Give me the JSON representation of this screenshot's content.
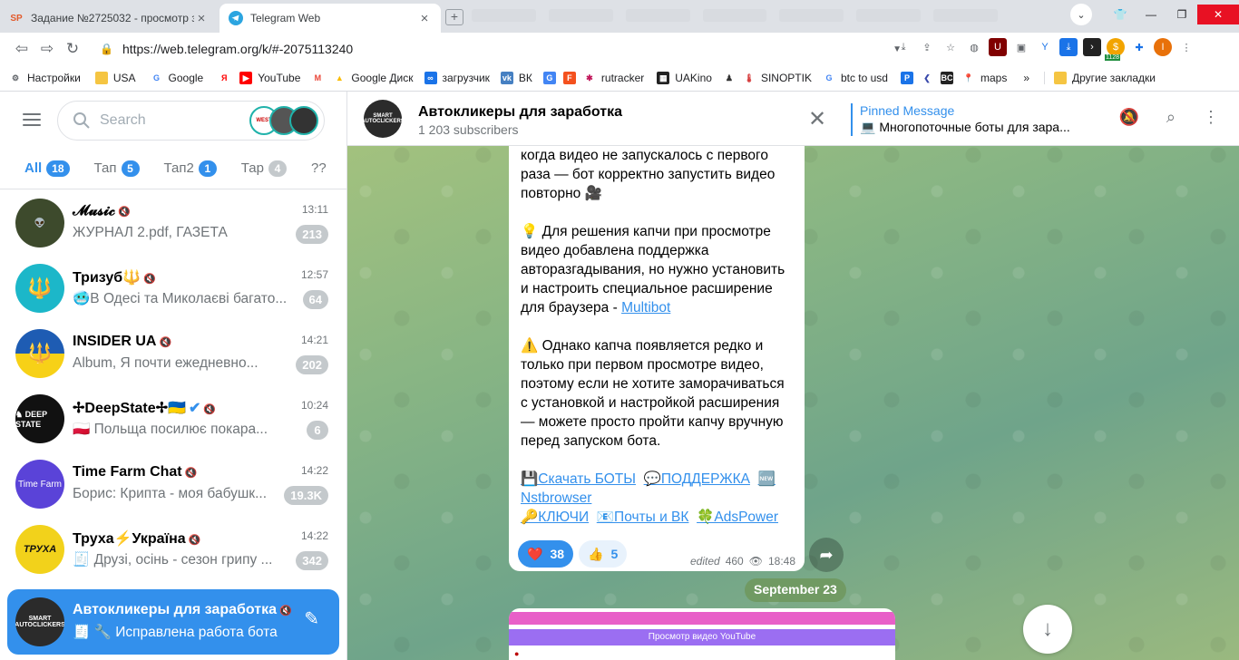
{
  "browser": {
    "tabs": [
      {
        "title": "Задание №2725032 - просмотр за...",
        "favicon": "SP",
        "active": false
      },
      {
        "title": "Telegram Web",
        "favicon": "telegram-icon",
        "active": true
      }
    ],
    "url": "https://web.telegram.org/k/#-2075113240",
    "ext_counter": "1128",
    "bookmarks": [
      {
        "label": "Настройки",
        "icon": "gear-icon"
      },
      {
        "label": "USA",
        "icon": "folder-icon"
      },
      {
        "label": "Google",
        "icon": "google-icon"
      },
      {
        "label": "",
        "icon": "yandex-icon"
      },
      {
        "label": "YouTube",
        "icon": "youtube-icon"
      },
      {
        "label": "",
        "icon": "gmail-icon"
      },
      {
        "label": "Google Диск",
        "icon": "drive-icon"
      },
      {
        "label": "загрузчик",
        "icon": "loader-icon"
      },
      {
        "label": "ВК",
        "icon": "vk-icon"
      },
      {
        "label": "",
        "icon": "translate-icon"
      },
      {
        "label": "",
        "icon": "f-icon"
      },
      {
        "label": "rutracker",
        "icon": "rutracker-icon"
      },
      {
        "label": "UAKino",
        "icon": "uakino-icon"
      },
      {
        "label": "",
        "icon": "person-icon"
      },
      {
        "label": "SINOPTIK",
        "icon": "thermometer-icon"
      },
      {
        "label": "btc to usd",
        "icon": "google-icon"
      },
      {
        "label": "",
        "icon": "p-icon"
      },
      {
        "label": "",
        "icon": "arrow-icon"
      },
      {
        "label": "",
        "icon": "bc-icon"
      },
      {
        "label": "maps",
        "icon": "maps-icon"
      }
    ],
    "bookmarks_more": "»",
    "other_bookmarks": "Другие закладки"
  },
  "sidebar": {
    "search_placeholder": "Search",
    "filters": [
      {
        "label": "All",
        "count": "18",
        "active": true
      },
      {
        "label": "Тап",
        "count": "5"
      },
      {
        "label": "Тап2",
        "count": "1"
      },
      {
        "label": "Тар",
        "count": "4"
      },
      {
        "label": "??",
        "count": ""
      }
    ],
    "chats": [
      {
        "name": "𝓜𝓾𝓼𝓲𝓬",
        "time": "13:11",
        "preview": "ЖУРНАЛ 2.pdf, ГАЗЕТА",
        "badge": "213",
        "avatar_color": "#3d4a2c"
      },
      {
        "name": "Тризуб🔱",
        "time": "12:57",
        "preview": "🥶В Одесі та Миколаєві багато...",
        "badge": "64",
        "avatar_color": "#1cb7c9"
      },
      {
        "name": "INSIDER UA",
        "time": "14:21",
        "preview": "Album, Я почти ежедневно...",
        "badge": "202",
        "avatar_color": "#1e5cb3"
      },
      {
        "name": "✢DeepState✢🇺🇦",
        "time": "10:24",
        "preview": "🇵🇱 Польща посилює покара...",
        "badge": "6",
        "avatar_color": "#111111"
      },
      {
        "name": "Time Farm Chat",
        "time": "14:22",
        "preview": "Борис: Крипта - моя бабушк...",
        "badge": "19.3K",
        "avatar_color": "#5a43d8"
      },
      {
        "name": "Труха⚡Україна",
        "time": "14:22",
        "preview": "🧾 Друзі, осінь - сезон грипу ...",
        "badge": "342",
        "avatar_color": "#f2d21b"
      },
      {
        "name": "Автокликеры для заработка",
        "time": "",
        "preview": "🧾 🔧 Исправлена работа бота",
        "badge": "",
        "avatar_color": "#2b2b2b"
      }
    ]
  },
  "chat": {
    "title": "Автокликеры для заработка",
    "subscribers": "1 203 subscribers",
    "pinned_label": "Pinned Message",
    "pinned_text": "💻 Многопоточные боты для зара...",
    "message": {
      "p1": "когда видео не запускалось с первого раза — бот корректно запустить видео повторно 🎥",
      "p2_text": "💡 Для решения капчи при просмотре видео добавлена поддержка авторазгадывания, но нужно установить и настроить специальное расширение для браузера - ",
      "p2_link": "Multibot",
      "p3": "⚠️ Однако капча появляется редко и только при первом просмотре видео, поэтому если не хотите заморачиваться с установкой и настройкой расширения — можете просто пройти капчу вручную перед запуском бота.",
      "link1": "💾Скачать БОТЫ",
      "link2": "💬ПОДДЕРЖКА",
      "link3": "🆕 Nstbrowser",
      "link4": "🔑КЛЮЧИ",
      "link5": "📧Почты и ВК",
      "link6": "🍀AdsPower",
      "reaction1_count": "38",
      "reaction2_count": "5",
      "edited": "edited",
      "views": "460",
      "time": "18:48"
    },
    "date_chip": "September 23",
    "next_bar": "Просмотр видео YouTube"
  }
}
